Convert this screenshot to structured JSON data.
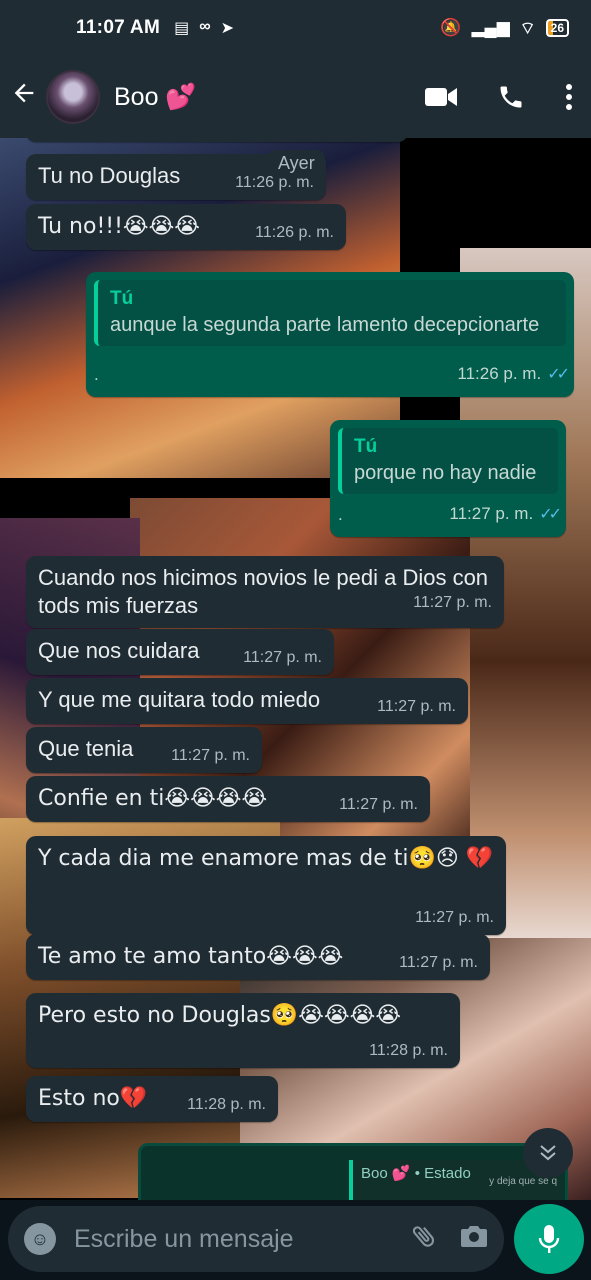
{
  "status_bar": {
    "time": "11:07 AM",
    "battery": "26"
  },
  "header": {
    "contact_name": "Boo 💕"
  },
  "date_chip": "Ayer",
  "messages": [
    {
      "dir": "in",
      "text": "Tu no Douglas",
      "time": "11:26 p. m."
    },
    {
      "dir": "in",
      "text": "Tu no!!!😭😭😭",
      "time": "11:26 p. m."
    },
    {
      "dir": "out",
      "quote_author": "Tú",
      "quote_text": "aunque la segunda parte lamento decepcionarte",
      "text": ".",
      "time": "11:26 p. m."
    },
    {
      "dir": "out",
      "quote_author": "Tú",
      "quote_text": "porque no hay nadie",
      "text": ".",
      "time": "11:27 p. m."
    },
    {
      "dir": "in",
      "text": "Cuando nos hicimos novios le pedi a Dios con tods mis fuerzas",
      "time": "11:27 p. m."
    },
    {
      "dir": "in",
      "text": "Que nos cuidara",
      "time": "11:27 p. m."
    },
    {
      "dir": "in",
      "text": "Y que me quitara todo miedo",
      "time": "11:27 p. m."
    },
    {
      "dir": "in",
      "text": "Que tenia",
      "time": "11:27 p. m."
    },
    {
      "dir": "in",
      "text": "Confie en ti😭😭😭😭",
      "time": "11:27 p. m."
    },
    {
      "dir": "in",
      "text": "Y cada dia me enamore mas de ti🥺😞 💔",
      "time": "11:27 p. m."
    },
    {
      "dir": "in",
      "text": "Te amo te amo tanto😭😭😭",
      "time": "11:27 p. m."
    },
    {
      "dir": "in",
      "text": "Pero esto no Douglas🥺😭😭😭😭",
      "time": "11:28 p. m."
    },
    {
      "dir": "in",
      "text": "Esto no💔",
      "time": "11:28 p. m."
    }
  ],
  "status_preview": {
    "title": "Boo 💕 • Estado",
    "sub": "y deja que se q"
  },
  "input": {
    "placeholder": "Escribe un mensaje"
  }
}
